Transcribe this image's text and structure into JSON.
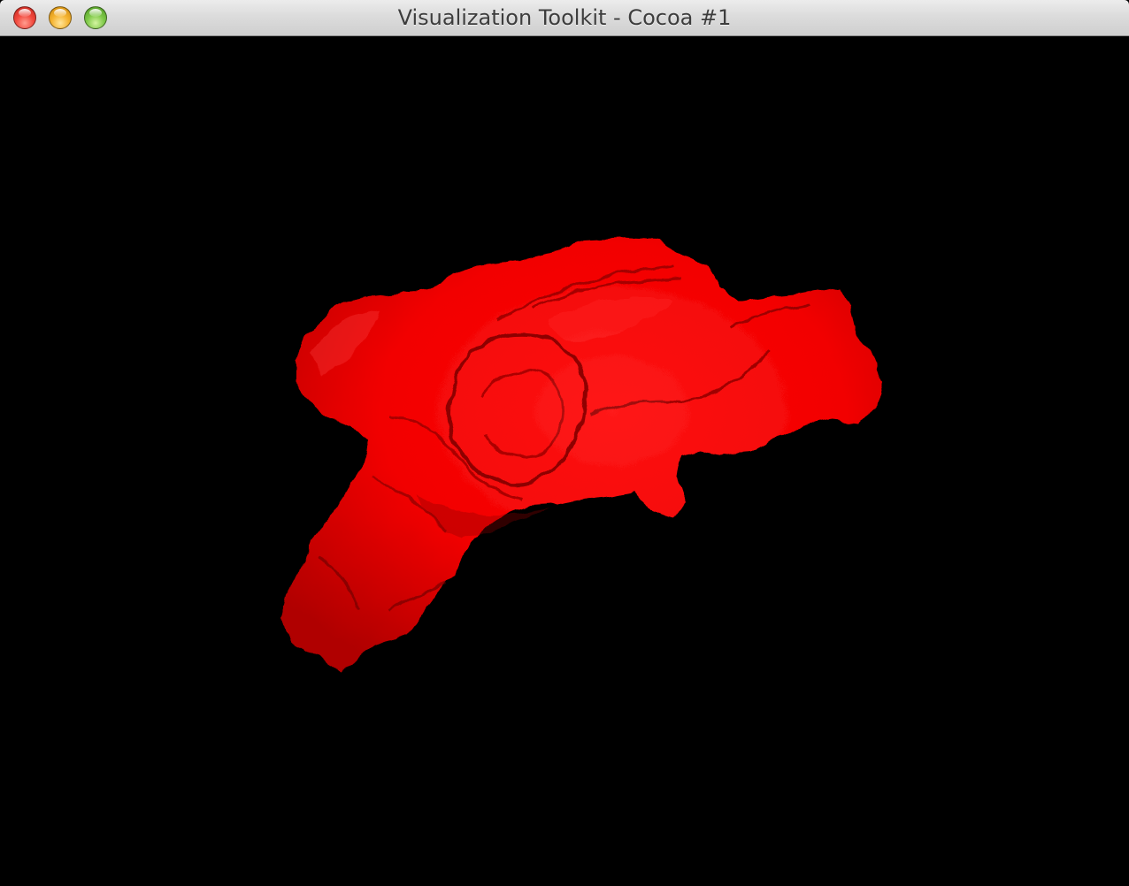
{
  "window": {
    "title": "Visualization Toolkit - Cocoa #1",
    "background_color": "#000000"
  },
  "titlebar": {
    "buttons": [
      {
        "name": "close",
        "color": "#f2493e"
      },
      {
        "name": "minimize",
        "color": "#f5b330"
      },
      {
        "name": "zoom",
        "color": "#7fc949"
      }
    ]
  },
  "render": {
    "object": "isosurface",
    "surface_color": "#ff0000",
    "shadow_color": "#5a0000"
  }
}
